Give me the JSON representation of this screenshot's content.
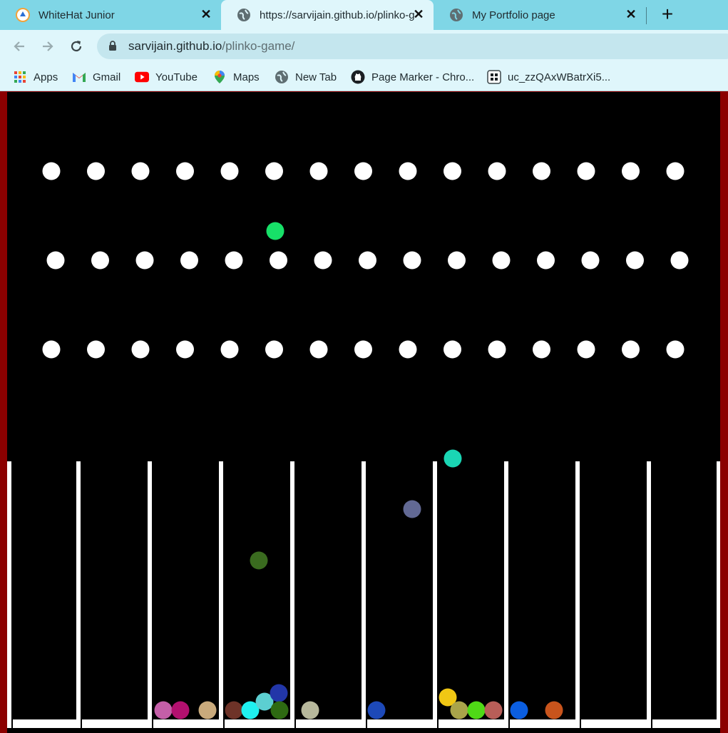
{
  "browser": {
    "tabs": [
      {
        "title": "WhiteHat Junior",
        "icon": "whitehat-icon",
        "active": false
      },
      {
        "title": "https://sarvijain.github.io/plinko-game/",
        "icon": "globe-icon",
        "active": true
      },
      {
        "title": "My Portfolio page",
        "icon": "globe-icon",
        "active": false
      }
    ],
    "address": {
      "host": "sarvijain.github.io",
      "path": "/plinko-game/"
    },
    "bookmarks": [
      {
        "label": "Apps",
        "icon": "apps-grid-icon"
      },
      {
        "label": "Gmail",
        "icon": "gmail-icon"
      },
      {
        "label": "YouTube",
        "icon": "youtube-icon"
      },
      {
        "label": "Maps",
        "icon": "maps-pin-icon"
      },
      {
        "label": "New Tab",
        "icon": "globe-icon"
      },
      {
        "label": "Page Marker - Chro...",
        "icon": "github-icon"
      },
      {
        "label": "uc_zzQAxWBatrXi5...",
        "icon": "dots-icon"
      }
    ]
  },
  "game": {
    "colors": {
      "background": "#000000",
      "frame": "#8b0000",
      "plinko": "#ffffff",
      "divisions": "#ffffff",
      "ground": "#ffffff"
    },
    "plinko_rows": 3,
    "plinko_columns": [
      15,
      15,
      15
    ],
    "division_count": 10,
    "particles": [
      {
        "color": "#17e068",
        "state": "falling"
      },
      {
        "color": "#1ad6b4",
        "state": "falling"
      },
      {
        "color": "#626994",
        "state": "falling"
      },
      {
        "color": "#3a6b1f",
        "state": "falling"
      },
      {
        "color": "#c45fa8",
        "state": "settled"
      },
      {
        "color": "#b3106f",
        "state": "settled"
      },
      {
        "color": "#c9aa7c",
        "state": "settled"
      },
      {
        "color": "#6e3328",
        "state": "settled"
      },
      {
        "color": "#1ff0f0",
        "state": "settled"
      },
      {
        "color": "#5ccfd1",
        "state": "settled"
      },
      {
        "color": "#2236a8",
        "state": "settled"
      },
      {
        "color": "#2e6a12",
        "state": "settled"
      },
      {
        "color": "#b7b89c",
        "state": "settled"
      },
      {
        "color": "#1d49b8",
        "state": "settled"
      },
      {
        "color": "#f0c714",
        "state": "settled"
      },
      {
        "color": "#a9a44a",
        "state": "settled"
      },
      {
        "color": "#4fd916",
        "state": "settled"
      },
      {
        "color": "#b85e58",
        "state": "settled"
      },
      {
        "color": "#0b5ee0",
        "state": "settled"
      },
      {
        "color": "#c8541c",
        "state": "settled"
      }
    ]
  }
}
